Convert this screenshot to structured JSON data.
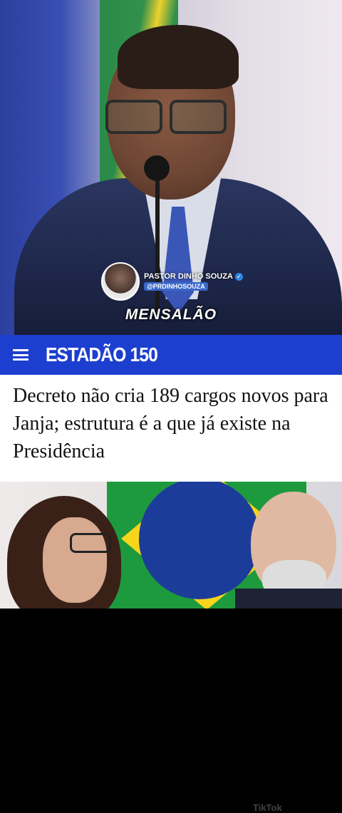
{
  "video": {
    "channel": {
      "name": "PASTOR DINHO SOUZA",
      "handle": "@PRDINHOSOUZA",
      "verified_icon": "verified-check-icon"
    },
    "caption": "MENSALÃO"
  },
  "news_header": {
    "menu_icon": "hamburger-menu-icon",
    "logo": "ESTADÃO 150",
    "bar_color": "#1d3fcf"
  },
  "article": {
    "headline": "Decreto não cria 189 cargos novos para Janja; estrutura é a que já existe na Presidência"
  },
  "watermark": {
    "label": "TikTok"
  }
}
